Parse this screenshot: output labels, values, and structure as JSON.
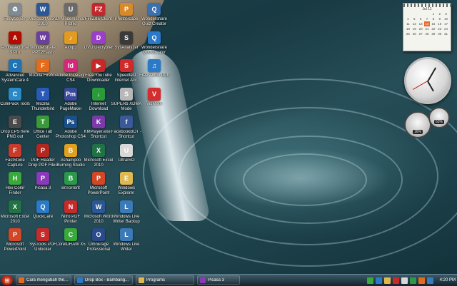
{
  "desktop": {
    "icons": [
      {
        "label": "Recycle Bin",
        "color": "#7f8a93",
        "glyph": "♻"
      },
      {
        "label": "Microsoft Word 2010",
        "color": "#2b5797",
        "glyph": "W"
      },
      {
        "label": "U_Modemsmart Profile",
        "color": "#6a6a6a",
        "glyph": "U"
      },
      {
        "label": "FileZilla Client",
        "color": "#c1272d",
        "glyph": "FZ"
      },
      {
        "label": "PhotoScape",
        "color": "#d88a2a",
        "glyph": "P"
      },
      {
        "label": "Wondershare Quiz Creator",
        "color": "#3a6fb0",
        "glyph": "Q"
      },
      {
        "label": "Adobe Acrobat 9 Pro",
        "color": "#b30b00",
        "glyph": "A"
      },
      {
        "label": "Wondershare PPT2Flash",
        "color": "#6b3fa0",
        "glyph": "W"
      },
      {
        "label": "Aimp3",
        "color": "#e09b20",
        "glyph": "♪"
      },
      {
        "label": "DVD Decrypter",
        "color": "#9a3fc8",
        "glyph": "D"
      },
      {
        "label": "SysAnalyzer",
        "color": "#3a3a3a",
        "glyph": "S"
      },
      {
        "label": "Wondershare QuizCreator",
        "color": "#2a78c8",
        "glyph": "Q"
      },
      {
        "label": "Advanced SystemCare 4",
        "color": "#1f74b8",
        "glyph": "C"
      },
      {
        "label": "Mozilla Firefox",
        "color": "#e46a1c",
        "glyph": "F"
      },
      {
        "label": "Adobe InDesign CS4",
        "color": "#d6287a",
        "glyph": "Id"
      },
      {
        "label": "Free YouTube Downloader",
        "color": "#c8282a",
        "glyph": "▶"
      },
      {
        "label": "Speedtest Internet Acc.",
        "color": "#d02a2a",
        "glyph": "S"
      },
      {
        "label": "Free Audio Dub",
        "color": "#2a7ac8",
        "glyph": "♫"
      },
      {
        "label": "CutePack Tools",
        "color": "#2a8ac8",
        "glyph": "C"
      },
      {
        "label": "Mozilla Thunderbird",
        "color": "#2a5ab8",
        "glyph": "T"
      },
      {
        "label": "Adobe PageMaker",
        "color": "#3a4a9a",
        "glyph": "Pm"
      },
      {
        "label": "Internet Download",
        "color": "#2a9a3a",
        "glyph": "↓"
      },
      {
        "label": "SUPERb XDMA Mode",
        "color": "#b8b8b8",
        "glyph": "S"
      },
      {
        "label": "VidMate",
        "color": "#d32d2d",
        "glyph": "V"
      },
      {
        "label": "Drop EPS here PNG out",
        "color": "#4a4a4a",
        "glyph": "E"
      },
      {
        "label": "Office Tab Center",
        "color": "#3a9a3a",
        "glyph": "T"
      },
      {
        "label": "Adobe Photoshop CS4",
        "color": "#1b4f8a",
        "glyph": "Ps"
      },
      {
        "label": "KMPlayer.exe - Shortcut",
        "color": "#7a3aa8",
        "glyph": "K"
      },
      {
        "label": "FacebookBOT - Shortcut",
        "color": "#3b5998",
        "glyph": "f"
      },
      {
        "label": "",
        "color": "rgba(0,0,0,0)",
        "glyph": ""
      },
      {
        "label": "FastStone Capture",
        "color": "#c83a2a",
        "glyph": "F"
      },
      {
        "label": "PDF Reader Drop PDF Files",
        "color": "#b3281e",
        "glyph": "P"
      },
      {
        "label": "Ashampoo Burning Studio",
        "color": "#e0a020",
        "glyph": "B"
      },
      {
        "label": "Microsoft Excel 2010",
        "color": "#217346",
        "glyph": "X"
      },
      {
        "label": "UltraISO",
        "color": "#d8d8d8",
        "glyph": "U"
      },
      {
        "label": "",
        "color": "rgba(0,0,0,0)",
        "glyph": ""
      },
      {
        "label": "Hex Color Finder",
        "color": "#3aa83a",
        "glyph": "H"
      },
      {
        "label": "Picasa 3",
        "color": "#8a3ab8",
        "glyph": "P"
      },
      {
        "label": "BitTorrent",
        "color": "#2a9a4a",
        "glyph": "B"
      },
      {
        "label": "Microsoft PowerPoint",
        "color": "#d24726",
        "glyph": "P"
      },
      {
        "label": "Windows Explorer",
        "color": "#e0b850",
        "glyph": "E"
      },
      {
        "label": "",
        "color": "rgba(0,0,0,0)",
        "glyph": ""
      },
      {
        "label": "Microsoft Excel 2010",
        "color": "#217346",
        "glyph": "X"
      },
      {
        "label": "QuickCare",
        "color": "#2a7ac8",
        "glyph": "Q"
      },
      {
        "label": "Nitro PDF Printer",
        "color": "#c82a2a",
        "glyph": "N"
      },
      {
        "label": "Microsoft Word 2010",
        "color": "#2b5797",
        "glyph": "W"
      },
      {
        "label": "Windows Live Writer Backup",
        "color": "#3a7ab8",
        "glyph": "L"
      },
      {
        "label": "",
        "color": "rgba(0,0,0,0)",
        "glyph": ""
      },
      {
        "label": "Microsoft PowerPoint",
        "color": "#d24726",
        "glyph": "P"
      },
      {
        "label": "SysTools PDF Unlocker",
        "color": "#c82a2a",
        "glyph": "S"
      },
      {
        "label": "CorelDRAW X5",
        "color": "#3aa83a",
        "glyph": "C"
      },
      {
        "label": "OmniPage Professional",
        "color": "#2a4a8a",
        "glyph": "O"
      },
      {
        "label": "Windows Live Writer",
        "color": "#3a7ab8",
        "glyph": "L"
      },
      {
        "label": "",
        "color": "rgba(0,0,0,0)",
        "glyph": ""
      }
    ]
  },
  "gadgets": {
    "calendar": {
      "month_label": "Jul 11",
      "days": [
        "",
        "",
        "",
        "",
        "1",
        "2",
        "3",
        "4",
        "5",
        "6",
        "7",
        "8",
        "9",
        "10",
        "11",
        "12",
        "13",
        "14",
        "15",
        "16",
        "17",
        "18",
        "19",
        "20",
        "21",
        "22",
        "23",
        "24",
        "25",
        "26",
        "27",
        "28",
        "29",
        "30",
        "31"
      ],
      "today": "14"
    },
    "meter": {
      "cpu_pct": "16%",
      "ram_pct": "63%"
    }
  },
  "taskbar": {
    "items": [
      {
        "label": "Cara mengubah the...",
        "color": "#e46a1c"
      },
      {
        "label": "Drop Box - Bambang...",
        "color": "#2a7ac8"
      },
      {
        "label": "Programs",
        "color": "#e0b850"
      },
      {
        "label": "Picasa 3",
        "color": "#8a3ab8"
      }
    ],
    "tray_colors": [
      "#3aa83a",
      "#2a7ac8",
      "#e0b850",
      "#c82a2a",
      "#d8d8d8",
      "#2a9a4a",
      "#e46a1c",
      "#3a7ab8"
    ],
    "time": "4:20 PM"
  }
}
